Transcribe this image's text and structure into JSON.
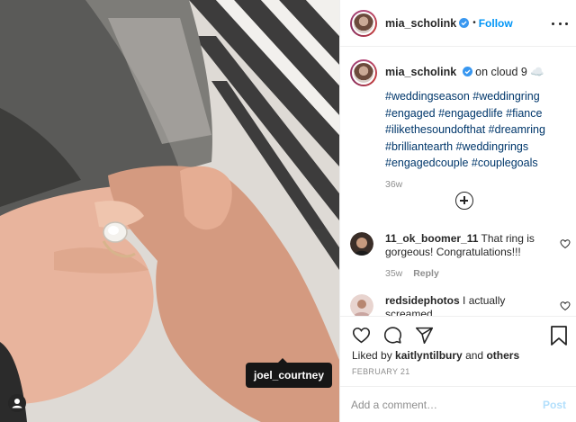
{
  "photo": {
    "tag_label": "joel_courtney"
  },
  "header": {
    "username": "mia_scholink",
    "separator": "•",
    "follow_label": "Follow"
  },
  "caption": {
    "username": "mia_scholink",
    "text": "on cloud 9 ☁️",
    "hashtags": [
      "#weddingseason",
      "#weddingring",
      "#engaged",
      "#engagedlife",
      "#fiance",
      "#ilikethesoundofthat",
      "#dreamring",
      "#brilliantearth",
      "#weddingrings",
      "#engagedcouple",
      "#couplegoals"
    ],
    "hashtag_lines": [
      "#weddingseason #weddingring",
      "#engaged #engagedlife #fiance",
      "#ilikethesoundofthat #dreamring",
      "#brilliantearth #weddingrings",
      "#engagedcouple #couplegoals"
    ],
    "time": "36w"
  },
  "comments": [
    {
      "username": "11_ok_boomer_11",
      "text": "That ring is gorgeous! Congratulations!!!",
      "time": "35w",
      "reply_label": "Reply"
    },
    {
      "username": "redsidephotos",
      "text": "I actually screamed. CONGRATULATIONS!!!!!!",
      "time": "",
      "reply_label": ""
    }
  ],
  "actions": {
    "liked_by_prefix": "Liked by",
    "liked_by_user": "kaitlyntilbury",
    "liked_by_and": "and",
    "liked_by_others": "others",
    "date": "FEBRUARY 21"
  },
  "comment_box": {
    "placeholder": "Add a comment…",
    "post_label": "Post"
  },
  "colors": {
    "follow_blue": "#0095f6",
    "hashtag_blue": "#00376b",
    "muted_gray": "#8e8e8e",
    "post_disabled": "#b2dffc"
  },
  "icons": [
    "verified-badge-icon",
    "more-options-icon",
    "add-comment-plus-icon",
    "heart-icon",
    "comment-icon",
    "share-icon",
    "save-bookmark-icon",
    "user-tag-icon"
  ]
}
